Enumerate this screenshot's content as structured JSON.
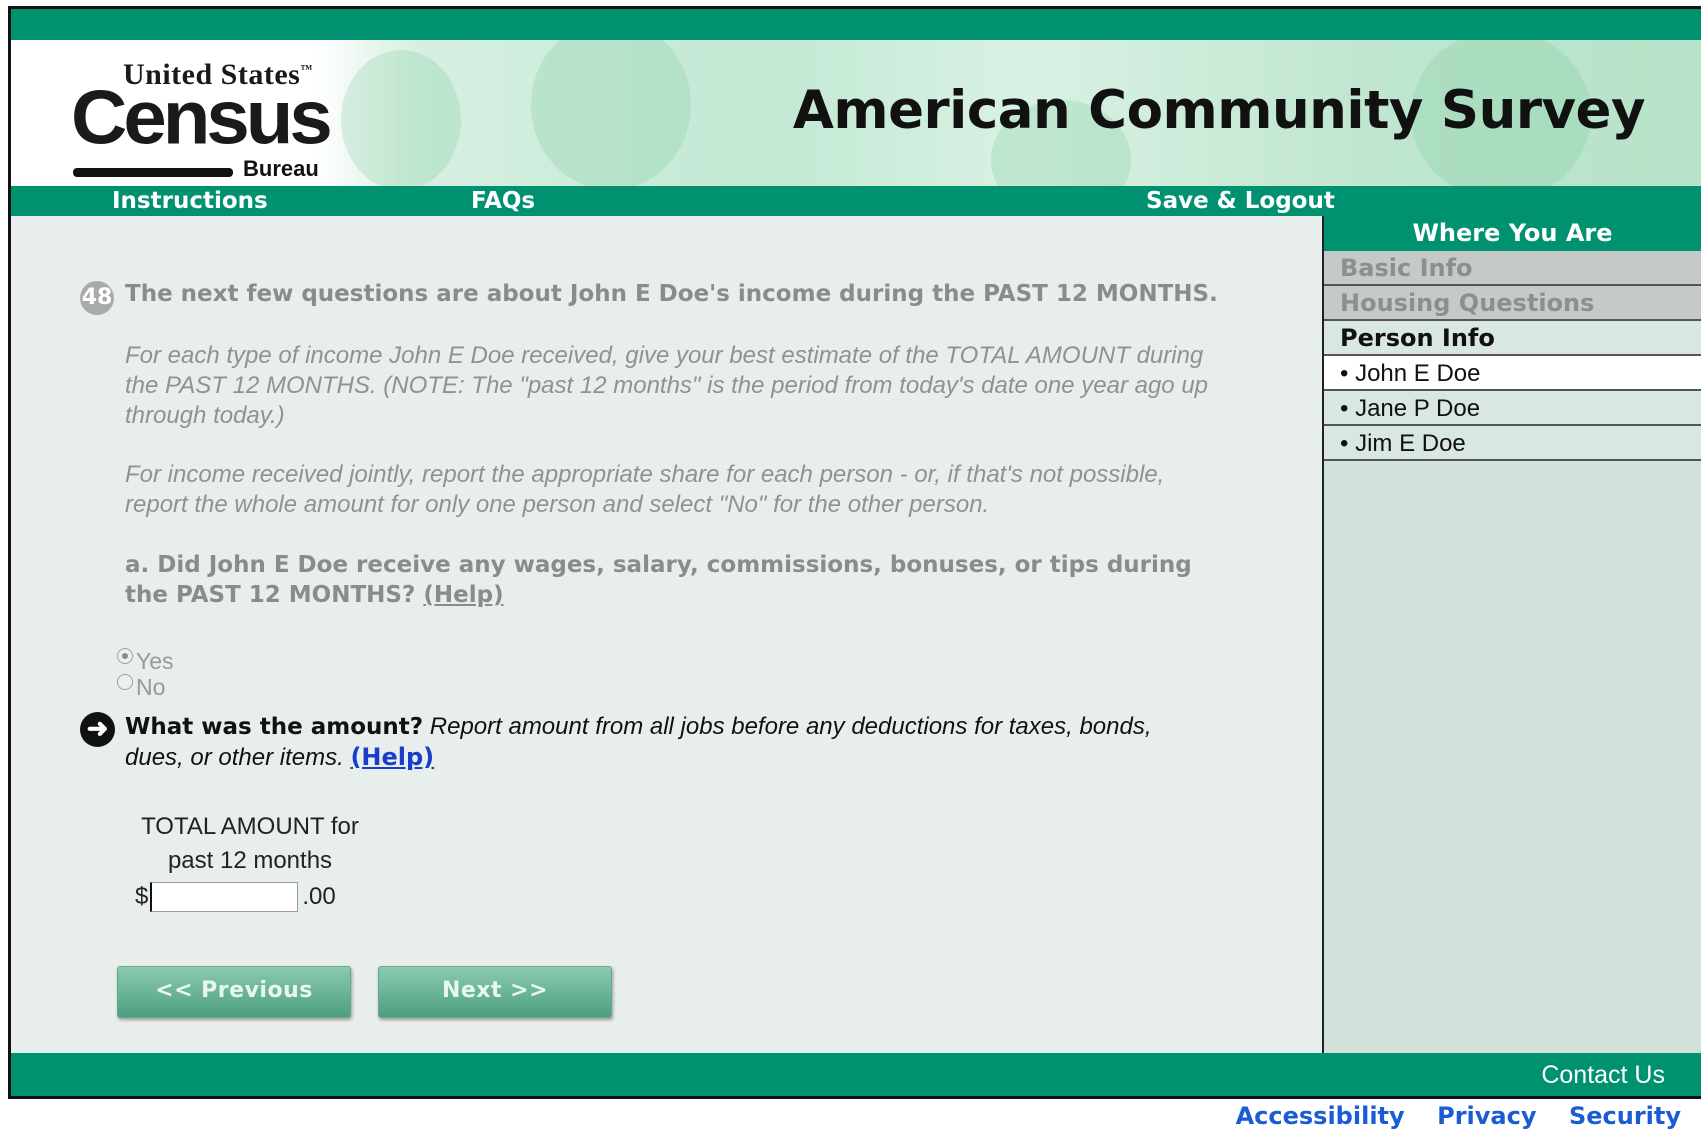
{
  "header": {
    "logo_line1": "United States",
    "logo_tm": "™",
    "logo_line2": "Census",
    "logo_line3": "Bureau",
    "survey_title": "American Community Survey"
  },
  "nav": {
    "instructions": "Instructions",
    "faqs": "FAQs",
    "save_logout": "Save & Logout"
  },
  "sidebar": {
    "heading": "Where You Are",
    "sections": [
      {
        "label": "Basic Info",
        "state": "completed"
      },
      {
        "label": "Housing Questions",
        "state": "completed"
      },
      {
        "label": "Person Info",
        "state": "current"
      }
    ],
    "people": [
      {
        "label": "• John E Doe",
        "active": true
      },
      {
        "label": "• Jane P Doe",
        "active": false
      },
      {
        "label": "• Jim E Doe",
        "active": false
      }
    ]
  },
  "question": {
    "number": "48",
    "text": "The next few questions are about John E Doe's income during the PAST 12 MONTHS.",
    "instruction_1": "For each type of income John E Doe received, give your best estimate of the TOTAL AMOUNT during the PAST 12 MONTHS. (NOTE: The \"past 12 months\" is the period from today's date one year ago up through today.)",
    "instruction_2": "For income received jointly, report the appropriate share for each person - or, if that's not possible, report the whole amount for only one person and select \"No\" for the other person.",
    "sub_a": "a. Did John E Doe receive any wages, salary, commissions, bonuses, or tips during the PAST 12 MONTHS?",
    "help_label": "(Help)",
    "options": [
      {
        "label": "Yes",
        "selected": true
      },
      {
        "label": "No",
        "selected": false
      }
    ],
    "followup_bold": "What was the amount?",
    "followup_italic": "Report amount from all jobs before any deductions for taxes, bonds, dues, or other items.",
    "followup_help": "(Help)",
    "total_label_line1": "TOTAL AMOUNT for",
    "total_label_line2": "past 12 months",
    "currency": "$",
    "cents": ".00",
    "amount_value": ""
  },
  "buttons": {
    "previous": "<<   Previous",
    "next": "Next   >>"
  },
  "footer": {
    "contact": "Contact Us",
    "links": [
      "Accessibility",
      "Privacy",
      "Security"
    ]
  },
  "colors": {
    "brand_green": "#009270",
    "sidebar_bg": "#d1e2da",
    "main_bg": "#e8eeeb",
    "link_blue": "#1a5bd6"
  }
}
